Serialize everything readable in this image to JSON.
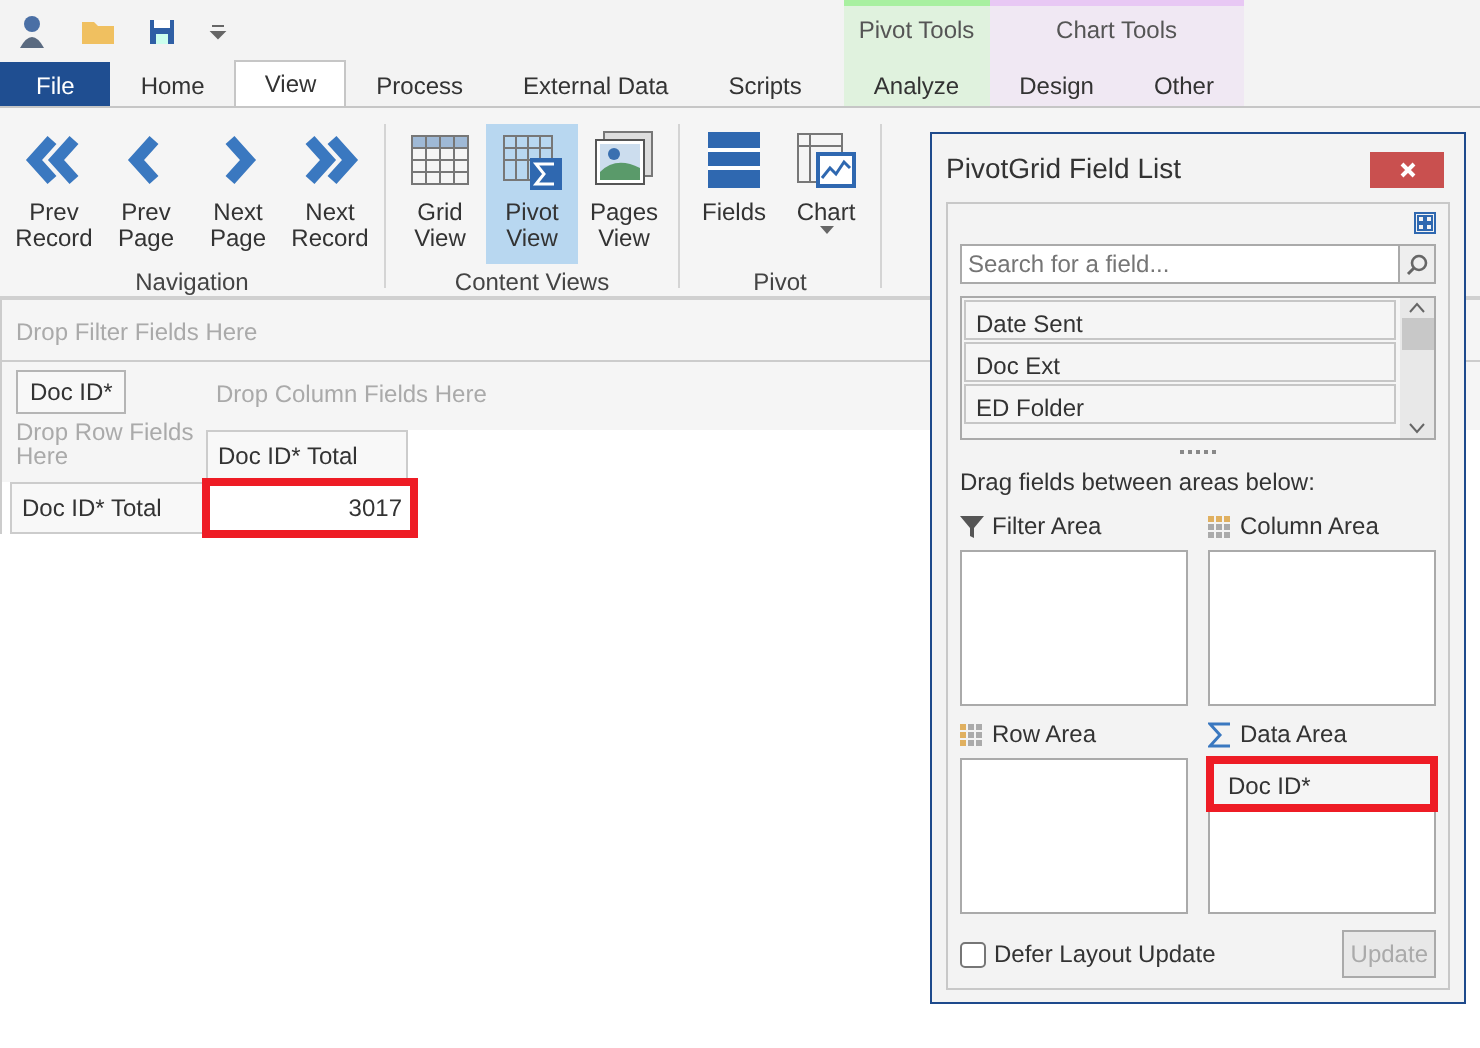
{
  "tabs": [
    {
      "label": "File",
      "kind": "file",
      "selected": false
    },
    {
      "label": "Home",
      "kind": "normal",
      "selected": false
    },
    {
      "label": "View",
      "kind": "normal",
      "selected": true
    },
    {
      "label": "Process",
      "kind": "normal",
      "selected": false
    },
    {
      "label": "External Data",
      "kind": "normal",
      "selected": false
    },
    {
      "label": "Scripts",
      "kind": "normal",
      "selected": false
    }
  ],
  "context_groups": [
    {
      "title": "Pivot Tools",
      "color": "#a8f0a0",
      "tabs": [
        {
          "label": "Analyze",
          "selected": false
        }
      ]
    },
    {
      "title": "Chart Tools",
      "color": "#e8c8f4",
      "tabs": [
        {
          "label": "Design",
          "selected": false
        },
        {
          "label": "Other",
          "selected": false
        }
      ]
    }
  ],
  "ribbon_groups": [
    {
      "label": "Navigation",
      "buttons": [
        {
          "label": "Prev Record",
          "kind": "first",
          "selected": false
        },
        {
          "label": "Prev Page",
          "kind": "prev",
          "selected": false
        },
        {
          "label": "Next Page",
          "kind": "next",
          "selected": false
        },
        {
          "label": "Next Record",
          "kind": "last",
          "selected": false
        }
      ]
    },
    {
      "label": "Content Views",
      "buttons": [
        {
          "label": "Grid View",
          "kind": "grid",
          "selected": false
        },
        {
          "label": "Pivot View",
          "kind": "pivot",
          "selected": true
        },
        {
          "label": "Pages View",
          "kind": "pages",
          "selected": false
        }
      ]
    },
    {
      "label": "Pivot",
      "buttons": [
        {
          "label": "Fields",
          "kind": "fields",
          "selected": false
        },
        {
          "label": "Chart",
          "kind": "chart",
          "selected": false,
          "dropdown": true
        }
      ]
    }
  ],
  "pivot": {
    "filter_hint": "Drop Filter Fields Here",
    "row_field": "Doc ID*",
    "column_hint": "Drop Column Fields Here",
    "row_hint": "Drop Row Fields Here",
    "column_header": "Doc ID* Total",
    "row_header": "Doc ID* Total",
    "cell": {
      "value": "3017",
      "highlighted": true
    }
  },
  "field_list": {
    "title": "PivotGrid Field List",
    "search": {
      "placeholder": "Search for a field..."
    },
    "fields": [
      "Date Sent",
      "Doc Ext",
      "ED Folder"
    ],
    "hint": "Drag fields between areas below:",
    "areas": [
      {
        "label": "Filter Area",
        "kind": "filter"
      },
      {
        "label": "Column Area",
        "kind": "column"
      },
      {
        "label": "Row Area",
        "kind": "row"
      },
      {
        "label": "Data Area",
        "kind": "data",
        "fields": [
          {
            "label": "Doc ID*",
            "highlighted": true
          }
        ]
      }
    ],
    "defer": {
      "label": "Defer Layout Update",
      "checked": false
    },
    "update": {
      "label": "Update",
      "disabled": true
    }
  }
}
